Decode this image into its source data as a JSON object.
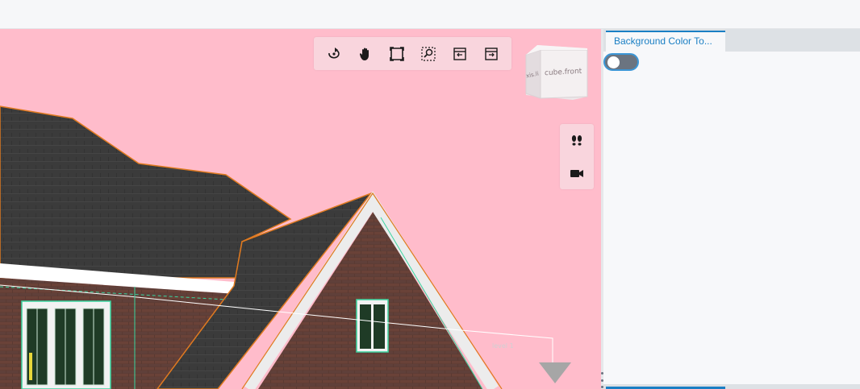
{
  "viewer": {
    "background_color": "#ffbccb",
    "toolbar": {
      "tools": [
        {
          "name": "orbit-tool",
          "icon": "orbit-icon"
        },
        {
          "name": "pan-tool",
          "icon": "hand-icon"
        },
        {
          "name": "fit-to-view-tool",
          "icon": "fit-view-icon"
        },
        {
          "name": "zoom-window-tool",
          "icon": "zoom-window-icon"
        },
        {
          "name": "previous-view-tool",
          "icon": "previous-view-icon"
        },
        {
          "name": "next-view-tool",
          "icon": "next-view-icon"
        }
      ]
    },
    "viewcube": {
      "front_label": "cube.front",
      "side_label": "xis.li"
    },
    "side_toolbar": {
      "tools": [
        {
          "name": "first-person-tool",
          "icon": "footprints-icon"
        },
        {
          "name": "camera-tool",
          "icon": "camera-icon"
        }
      ]
    },
    "scene_label": "level 1"
  },
  "panel": {
    "tab_label": "Background Color To...",
    "toggle": {
      "on": false
    },
    "accent_color": "#1a7fc4"
  }
}
